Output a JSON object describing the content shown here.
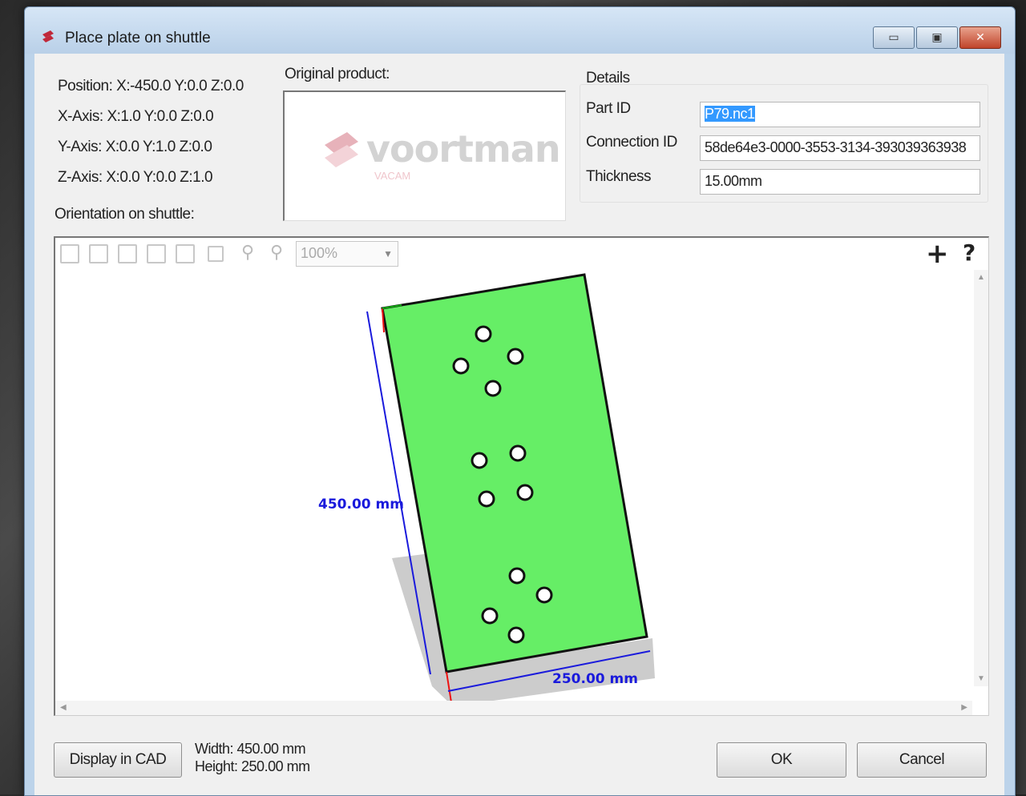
{
  "window": {
    "title": "Place plate on shuttle",
    "controls": {
      "minimize": "▭",
      "maximize": "▣",
      "close": "✕"
    }
  },
  "info": {
    "position": "Position: X:-450.0 Y:0.0 Z:0.0",
    "x_axis": "X-Axis: X:1.0 Y:0.0 Z:0.0",
    "y_axis": "Y-Axis: X:0.0 Y:1.0 Z:0.0",
    "z_axis": "Z-Axis: X:0.0 Y:0.0 Z:1.0",
    "orientation_label": "Orientation on shuttle:"
  },
  "original_product": {
    "label": "Original product:",
    "logo_text": "voortman",
    "logo_sub": "VACAM"
  },
  "details": {
    "label": "Details",
    "part_id_label": "Part ID",
    "part_id_value": "P79.nc1",
    "connection_id_label": "Connection ID",
    "connection_id_value": "58de64e3-0000-3553-3134-393039363938",
    "thickness_label": "Thickness",
    "thickness_value": "15.00mm"
  },
  "viewer": {
    "zoom": "100%",
    "plus": "+",
    "help": "?",
    "dim_height": "450.00 mm",
    "dim_width": "250.00 mm",
    "plate_color": "#66ee66",
    "shadow_color": "#cccccc",
    "dim_color": "#1a1adc"
  },
  "footer": {
    "display_cad": "Display in CAD",
    "width_text": "Width: 450.00 mm",
    "height_text": "Height: 250.00 mm",
    "ok": "OK",
    "cancel": "Cancel"
  }
}
